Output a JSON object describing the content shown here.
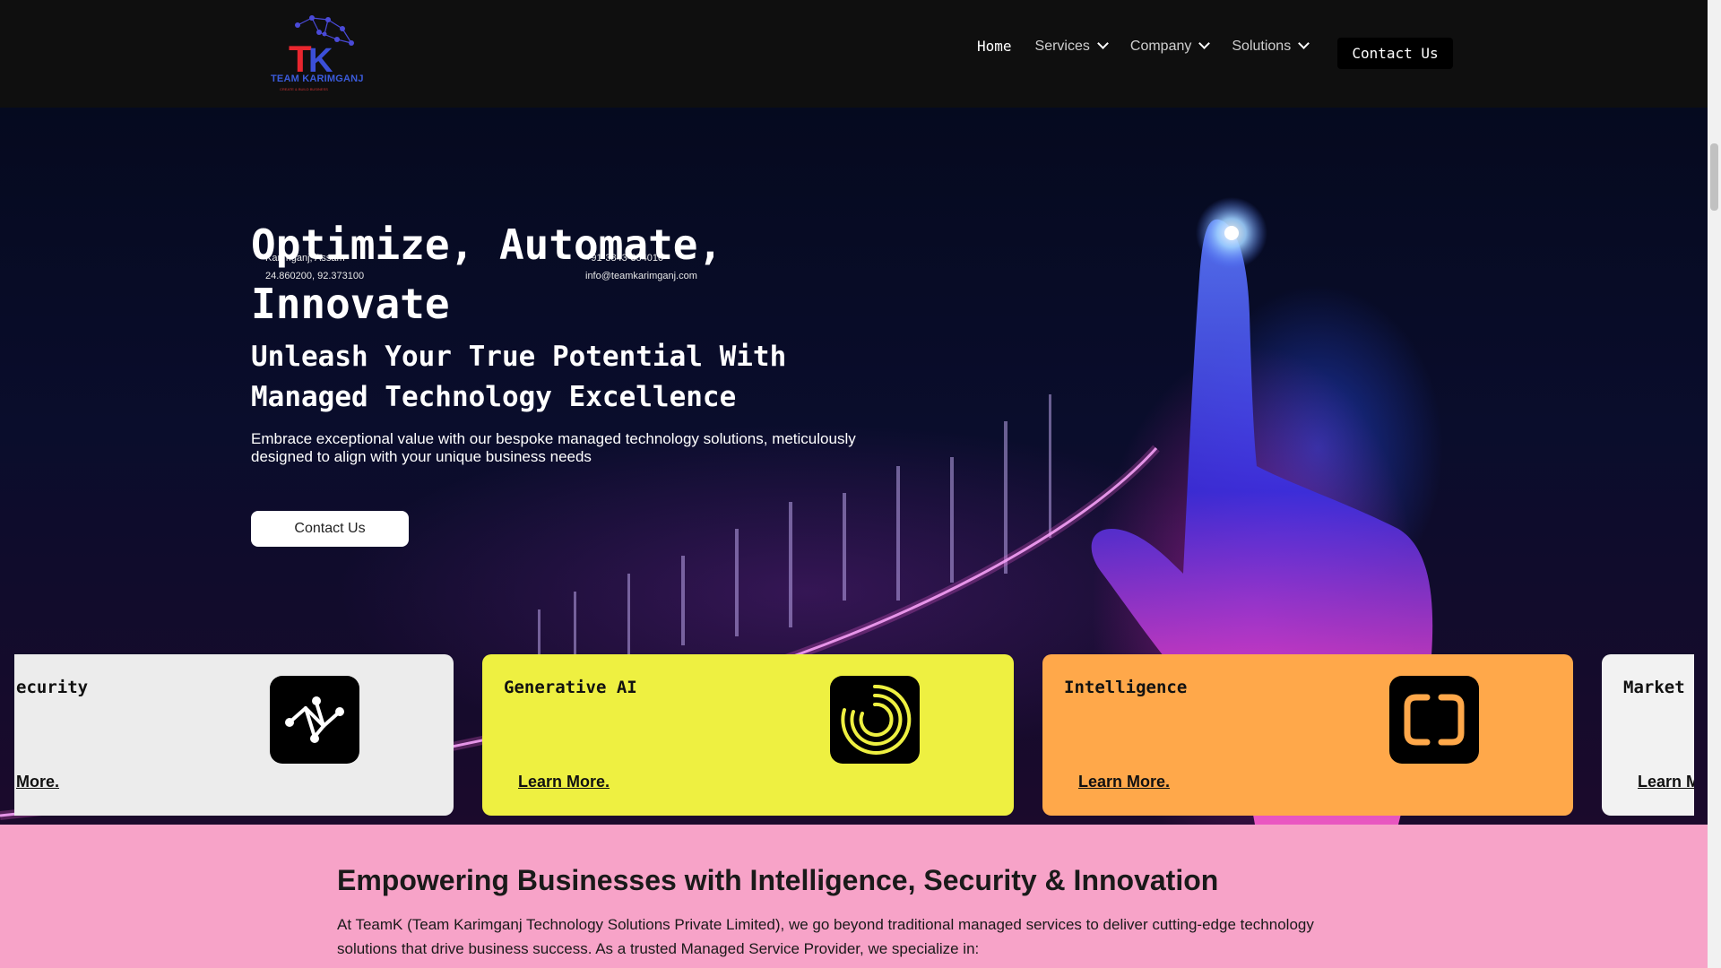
{
  "header": {
    "logo_text": "TEAM KARIMGANJ",
    "logo_subtext": "CREATE & BUILD BUSINESS",
    "nav": [
      {
        "label": "Home"
      },
      {
        "label": "Services"
      },
      {
        "label": "Company"
      },
      {
        "label": "Solutions"
      }
    ],
    "cta_label": "Contact Us"
  },
  "contact": {
    "address_line1": "Karimganj, Assam",
    "address_line2": "24.860200, 92.373100",
    "phone": "+91-3843-354010",
    "email": "info@teamkarimganj.com"
  },
  "hero": {
    "title": "Optimize, Automate, Innovate",
    "subtitle": "Unleash Your True Potential With Managed Technology Excellence",
    "body": "Embrace exceptional value with our bespoke managed technology solutions, meticulously designed to align with your unique business needs",
    "cta_label": "Contact Us"
  },
  "cards": [
    {
      "title": "ecurity",
      "link": "More.",
      "color": "#ececec",
      "icon": "network-nodes-icon"
    },
    {
      "title": "Generative AI",
      "link": "Learn More.",
      "color": "#eef041",
      "icon": "spiral-rings-icon"
    },
    {
      "title": "Intelligence",
      "link": "Learn More.",
      "color": "#ffa84a",
      "icon": "rounded-brackets-icon"
    },
    {
      "title": "Market I",
      "link": "Learn M",
      "color": "#f2f2f2",
      "icon": ""
    }
  ],
  "intro": {
    "heading": "Empowering Businesses with Intelligence, Security & Innovation",
    "paragraph": "At TeamK (Team Karimganj Technology Solutions Private Limited), we go beyond traditional managed services to deliver cutting-edge technology solutions that drive business success. As a trusted Managed Service Provider, we specialize in:"
  }
}
